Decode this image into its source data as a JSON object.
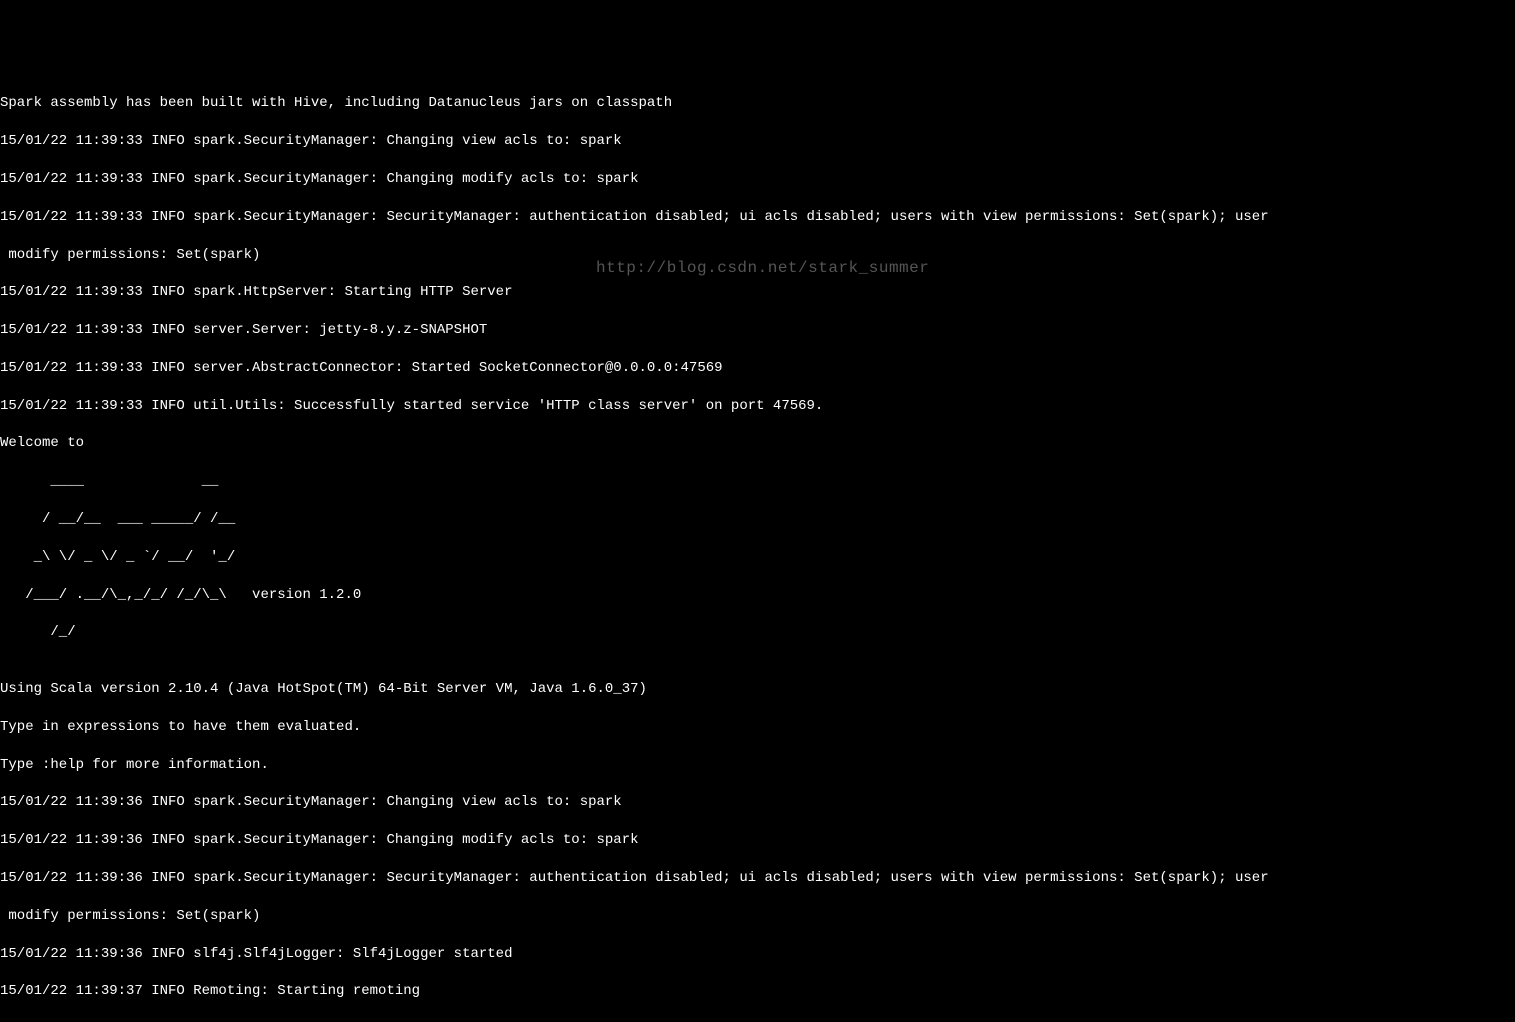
{
  "terminal": {
    "lines": [
      "Spark assembly has been built with Hive, including Datanucleus jars on classpath",
      "15/01/22 11:39:33 INFO spark.SecurityManager: Changing view acls to: spark",
      "15/01/22 11:39:33 INFO spark.SecurityManager: Changing modify acls to: spark",
      "15/01/22 11:39:33 INFO spark.SecurityManager: SecurityManager: authentication disabled; ui acls disabled; users with view permissions: Set(spark); user",
      " modify permissions: Set(spark)",
      "15/01/22 11:39:33 INFO spark.HttpServer: Starting HTTP Server",
      "15/01/22 11:39:33 INFO server.Server: jetty-8.y.z-SNAPSHOT",
      "15/01/22 11:39:33 INFO server.AbstractConnector: Started SocketConnector@0.0.0.0:47569",
      "15/01/22 11:39:33 INFO util.Utils: Successfully started service 'HTTP class server' on port 47569.",
      "Welcome to",
      "      ____              __",
      "     / __/__  ___ _____/ /__",
      "    _\\ \\/ _ \\/ _ `/ __/  '_/",
      "   /___/ .__/\\_,_/_/ /_/\\_\\   version 1.2.0",
      "      /_/",
      "",
      "Using Scala version 2.10.4 (Java HotSpot(TM) 64-Bit Server VM, Java 1.6.0_37)",
      "Type in expressions to have them evaluated.",
      "Type :help for more information.",
      "15/01/22 11:39:36 INFO spark.SecurityManager: Changing view acls to: spark",
      "15/01/22 11:39:36 INFO spark.SecurityManager: Changing modify acls to: spark",
      "15/01/22 11:39:36 INFO spark.SecurityManager: SecurityManager: authentication disabled; ui acls disabled; users with view permissions: Set(spark); user",
      " modify permissions: Set(spark)",
      "15/01/22 11:39:36 INFO slf4j.Slf4jLogger: Slf4jLogger started",
      "15/01/22 11:39:37 INFO Remoting: Starting remoting"
    ]
  },
  "watermark": {
    "text": "http://blog.csdn.net/stark_summer"
  }
}
